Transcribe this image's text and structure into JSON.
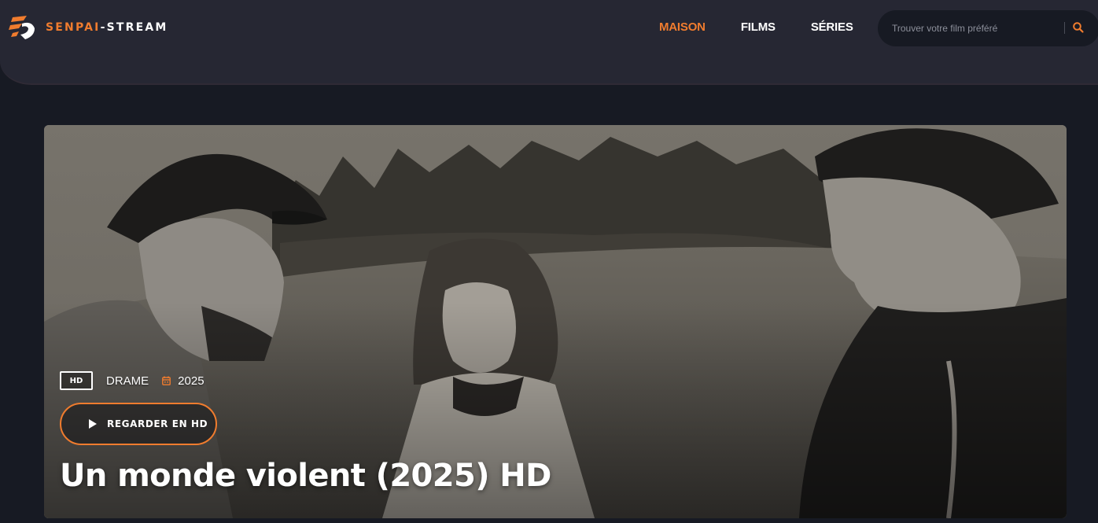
{
  "header": {
    "logo": {
      "part1": "SENPAI",
      "part2": "-STREAM"
    },
    "nav": [
      {
        "label": "MAISON",
        "active": true
      },
      {
        "label": "FILMS",
        "active": false
      },
      {
        "label": "SÉRIES",
        "active": false
      }
    ],
    "search": {
      "placeholder": "Trouver votre film préféré",
      "value": ""
    }
  },
  "hero": {
    "quality_badge": "HD",
    "genre": "DRAME",
    "year": "2025",
    "watch_button_label": "REGARDER EN HD",
    "title": "Un monde violent (2025) HD"
  },
  "colors": {
    "accent": "#f07c2e",
    "header_bg": "#262733",
    "page_bg": "#171a23"
  },
  "icons": {
    "logo": "logo-icon",
    "search": "search-icon",
    "calendar": "calendar-icon",
    "play": "play-icon"
  }
}
